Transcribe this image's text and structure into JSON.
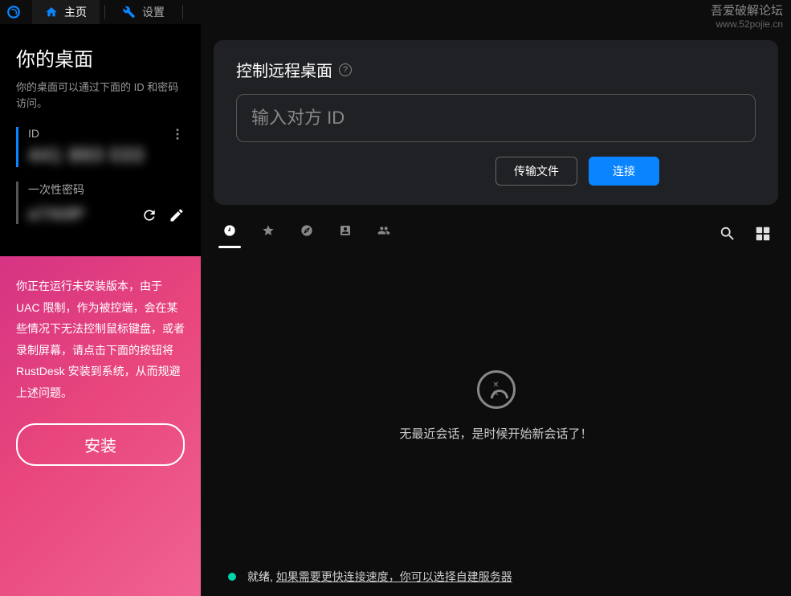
{
  "watermark": {
    "title": "吾爱破解论坛",
    "url": "www.52pojie.cn"
  },
  "tabs": {
    "home": "主页",
    "settings": "设置"
  },
  "sidebar": {
    "title": "你的桌面",
    "desc": "你的桌面可以通过下面的 ID 和密码访问。",
    "id_label": "ID",
    "id_value": "441 893 033",
    "pw_label": "一次性密码",
    "pw_value": "a7Xk9P"
  },
  "install": {
    "text": "你正在运行未安装版本，由于 UAC 限制，作为被控端，会在某些情况下无法控制鼠标键盘，或者录制屏幕，请点击下面的按钮将 RustDesk 安装到系统，从而规避上述问题。",
    "button": "安装"
  },
  "remote": {
    "title": "控制远程桌面",
    "placeholder": "输入对方 ID",
    "transfer_btn": "传输文件",
    "connect_btn": "连接"
  },
  "empty": {
    "text": "无最近会话，是时候开始新会话了！"
  },
  "status": {
    "ready": "就绪,",
    "hint": "如果需要更快连接速度，你可以选择自建服务器"
  }
}
